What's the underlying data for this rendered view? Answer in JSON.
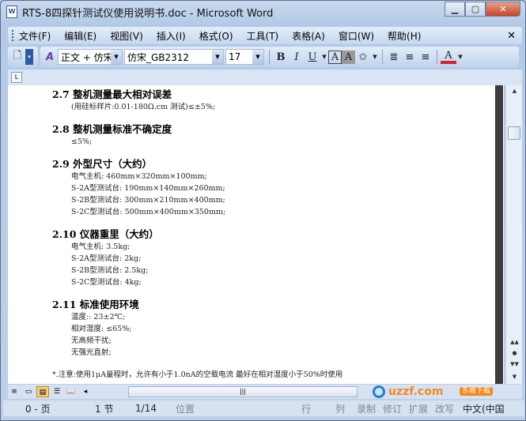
{
  "window": {
    "title": "RTS-8四探针测试仪使用说明书.doc - Microsoft Word",
    "app_icon": "W"
  },
  "menu": [
    "文件(F)",
    "编辑(E)",
    "视图(V)",
    "插入(I)",
    "格式(O)",
    "工具(T)",
    "表格(A)",
    "窗口(W)",
    "帮助(H)"
  ],
  "toolbar": {
    "style": "正文 + 仿宋",
    "font": "仿宋_GB2312",
    "size": "17",
    "bold": "B",
    "italic": "I",
    "underline": "U",
    "font_color_accent": "#d8222b"
  },
  "doc": {
    "sections": [
      {
        "heading": "2.7 整机测量最大相对误差",
        "lines": [
          "(用硅标样片:0.01-180Ω.cm 测试)≤±5%;"
        ]
      },
      {
        "heading": "2.8 整机测量标准不确定度",
        "lines": [
          "≤5%;"
        ]
      },
      {
        "heading": "2.9 外型尺寸（大约）",
        "lines": [
          "电气主机: 460mm×320mm×100mm;",
          "S-2A型测试台: 190mm×140mm×260mm;",
          "S-2B型测试台: 300mm×210mm×400mm;",
          "S-2C型测试台: 500mm×400mm×350mm;"
        ]
      },
      {
        "heading": "2.10 仪器重里（大约）",
        "lines": [
          "电气主机: 3.5kg;",
          "S-2A型测试台: 2kg;",
          "S-2B型测试台: 2.5kg;",
          "S-2C型测试台: 4kg;"
        ]
      },
      {
        "heading": "2.11 标准使用环境",
        "lines": [
          "温度:: 23±2℃;",
          "相对湿度: ≤65%;",
          "无高频干扰;",
          "无强光直射;"
        ]
      }
    ],
    "note": "*.注意:使用1μA量程时，允许有小于1.0nA的空载电流 最好在相对湿度小于50%时使用"
  },
  "status": {
    "page": "0 - 页",
    "section": "1 节",
    "pages": "1/14",
    "position": "位置",
    "line": "行",
    "col": "列",
    "rec": "录制",
    "trk": "修订",
    "ext": "扩展",
    "ovr": "改写",
    "lang": "中文(中国"
  },
  "watermark": {
    "text": "uzzf.com",
    "badge": "东坡下载"
  }
}
